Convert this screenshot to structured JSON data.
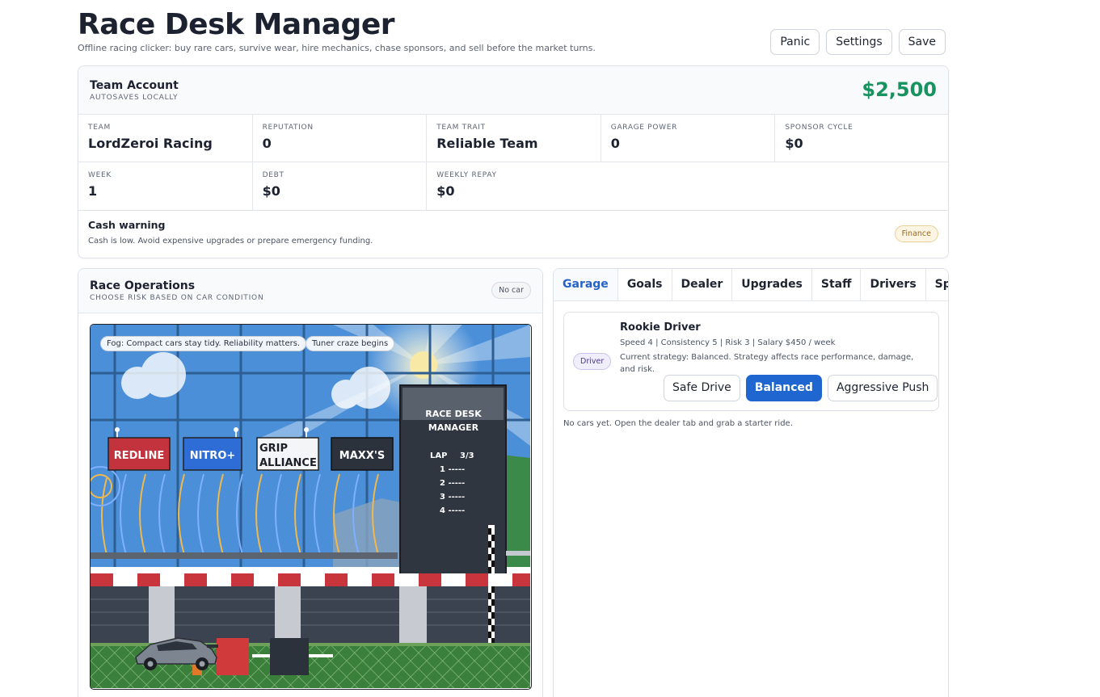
{
  "header": {
    "title": "Race Desk Manager",
    "subtitle": "Offline racing clicker: buy rare cars, survive wear, hire mechanics, chase sponsors, and sell before the market turns.",
    "buttons": [
      "Panic",
      "Settings",
      "Save"
    ]
  },
  "account": {
    "title": "Team Account",
    "subtitle": "AUTOSAVES LOCALLY",
    "cash": "$2,500",
    "stats": [
      {
        "label": "TEAM",
        "value": "LordZeroi Racing"
      },
      {
        "label": "REPUTATION",
        "value": "0"
      },
      {
        "label": "TEAM TRAIT",
        "value": "Reliable Team"
      },
      {
        "label": "GARAGE POWER",
        "value": "0"
      },
      {
        "label": "SPONSOR CYCLE",
        "value": "$0"
      },
      {
        "label": "WEEK",
        "value": "1"
      },
      {
        "label": "DEBT",
        "value": "$0"
      },
      {
        "label": "WEEKLY REPAY",
        "value": "$0"
      }
    ],
    "warning": {
      "title": "Cash warning",
      "text": "Cash is low. Avoid expensive upgrades or prepare emergency funding.",
      "badge": "Finance"
    }
  },
  "race": {
    "title": "Race Operations",
    "subtitle": "CHOOSE RISK BASED ON CAR CONDITION",
    "badge": "No car",
    "weather": [
      "Fog: Compact cars stay tidy. Reliability matters.",
      "Tuner craze begins"
    ],
    "sponsors": [
      "REDLINE",
      "NITRO+",
      "GRIP",
      "ALLIANCE",
      "MAXX'S"
    ],
    "board": {
      "title_line1": "RACE DESK",
      "title_line2": "MANAGER",
      "lap_label": "LAP",
      "lap_value": "3/3",
      "positions": [
        "1 -----",
        "2 -----",
        "3 -----",
        "4 -----"
      ]
    },
    "colors": {
      "sky": "#4b8fd9",
      "grass": "#5f8f46",
      "track": "#3c4350",
      "kerb_red": "#c9353c",
      "board": "#2f3640"
    }
  },
  "panel": {
    "tabs": [
      "Garage",
      "Goals",
      "Dealer",
      "Upgrades",
      "Staff",
      "Drivers",
      "Sponsors"
    ],
    "active_tab": "Garage",
    "driver": {
      "badge": "Driver",
      "name": "Rookie Driver",
      "stats": "Speed 4 | Consistency 5 | Risk 3 | Salary $450 / week",
      "strategy": "Current strategy: Balanced. Strategy affects race performance, damage, and risk.",
      "buttons": [
        "Safe Drive",
        "Balanced",
        "Aggressive Push"
      ]
    },
    "empty_note": "No cars yet. Open the dealer tab and grab a starter ride."
  }
}
